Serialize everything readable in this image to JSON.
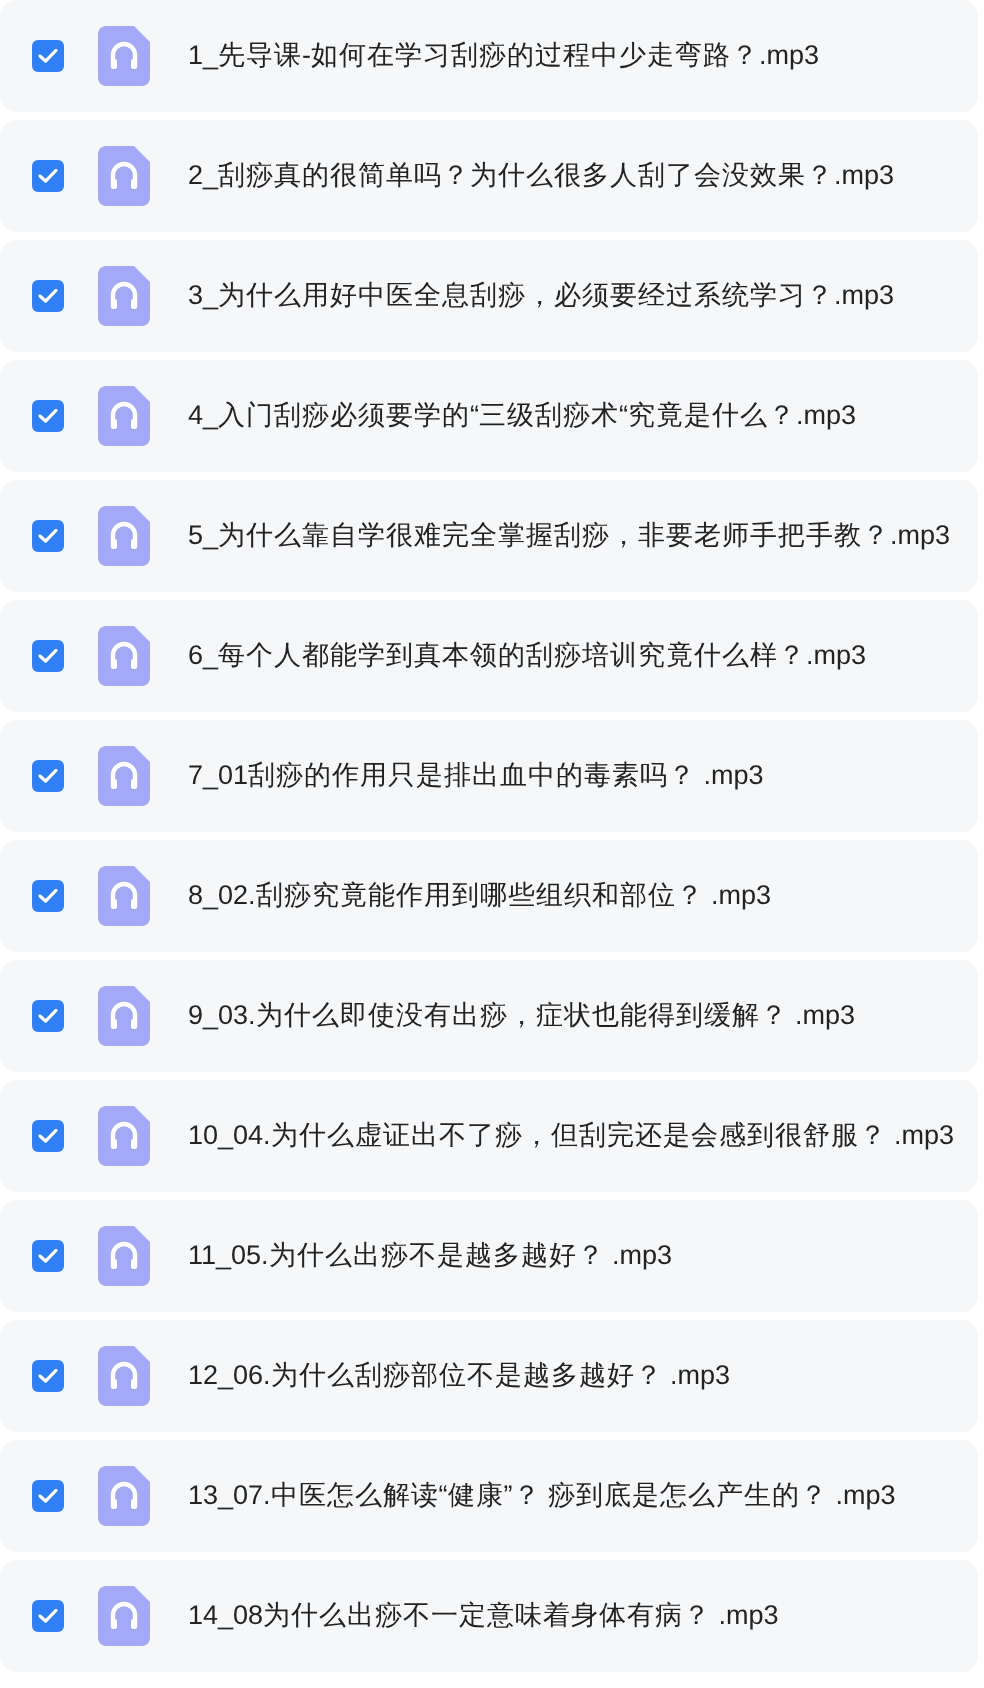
{
  "files": [
    {
      "name": "1_先导课-如何在学习刮痧的过程中少走弯路？.mp3",
      "checked": true
    },
    {
      "name": "2_刮痧真的很简单吗？为什么很多人刮了会没效果？.mp3",
      "checked": true
    },
    {
      "name": "3_为什么用好中医全息刮痧，必须要经过系统学习？.mp3",
      "checked": true
    },
    {
      "name": "4_入门刮痧必须要学的“三级刮痧术“究竟是什么？.mp3",
      "checked": true
    },
    {
      "name": "5_为什么靠自学很难完全掌握刮痧，非要老师手把手教？.mp3",
      "checked": true
    },
    {
      "name": "6_每个人都能学到真本领的刮痧培训究竟什么样？.mp3",
      "checked": true
    },
    {
      "name": "7_01刮痧的作用只是排出血中的毒素吗？ .mp3",
      "checked": true
    },
    {
      "name": "8_02.刮痧究竟能作用到哪些组织和部位？ .mp3",
      "checked": true
    },
    {
      "name": "9_03.为什么即使没有出痧，症状也能得到缓解？ .mp3",
      "checked": true
    },
    {
      "name": "10_04.为什么虚证出不了痧，但刮完还是会感到很舒服？ .mp3",
      "checked": true
    },
    {
      "name": "11_05.为什么出痧不是越多越好？ .mp3",
      "checked": true
    },
    {
      "name": "12_06.为什么刮痧部位不是越多越好？ .mp3",
      "checked": true
    },
    {
      "name": "13_07.中医怎么解读“健康”？ 痧到底是怎么产生的？ .mp3",
      "checked": true
    },
    {
      "name": "14_08为什么出痧不一定意味着身体有病？ .mp3",
      "checked": true
    }
  ]
}
